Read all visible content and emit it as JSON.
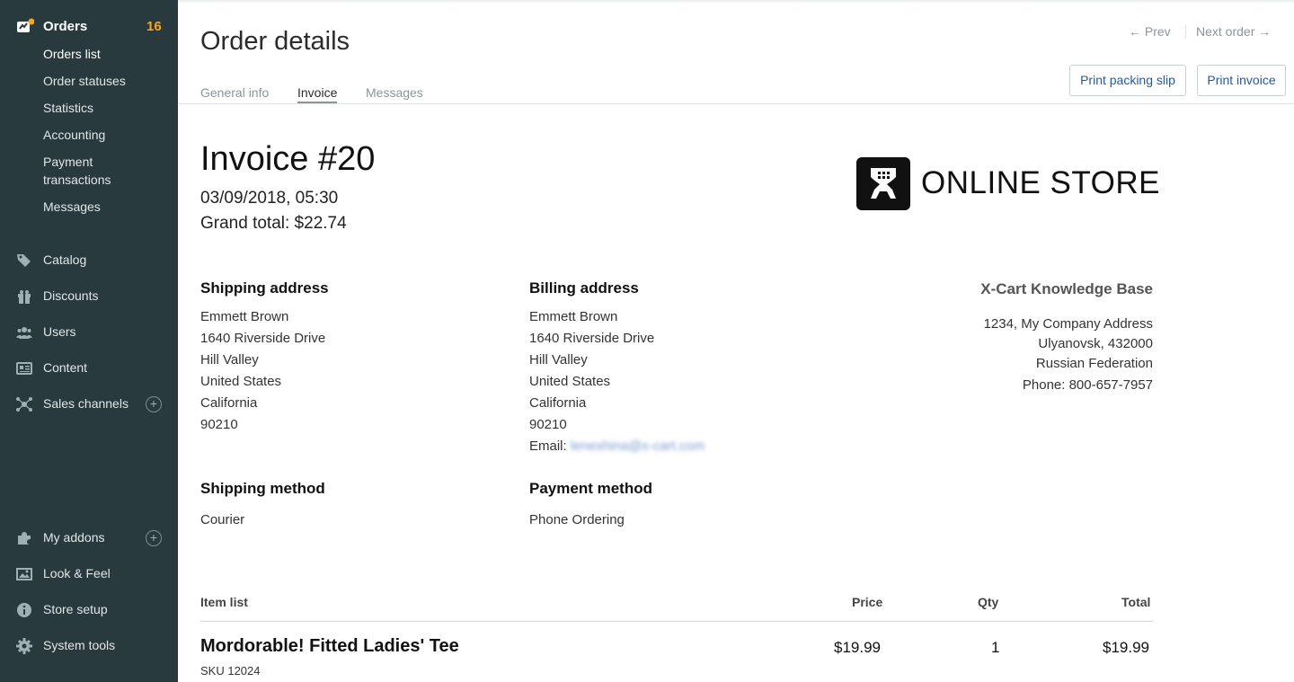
{
  "sidebar": {
    "orders": {
      "label": "Orders",
      "count": "16"
    },
    "sub_items": [
      "Orders list",
      "Order statuses",
      "Statistics",
      "Accounting",
      "Payment",
      "transactions",
      "Messages"
    ],
    "main_items": [
      {
        "label": "Catalog",
        "icon": "tags-icon"
      },
      {
        "label": "Discounts",
        "icon": "gift-icon"
      },
      {
        "label": "Users",
        "icon": "users-icon"
      },
      {
        "label": "Content",
        "icon": "newspaper-icon"
      },
      {
        "label": "Sales channels",
        "icon": "network-icon"
      },
      {
        "label": "My addons",
        "icon": "puzzle-icon"
      },
      {
        "label": "Look & Feel",
        "icon": "image-icon"
      },
      {
        "label": "Store setup",
        "icon": "info-icon"
      },
      {
        "label": "System tools",
        "icon": "gear-icon"
      }
    ]
  },
  "header": {
    "title": "Order details",
    "tabs": [
      "General info",
      "Invoice",
      "Messages"
    ],
    "prev": "←  Prev",
    "next": "Next order  →",
    "print_packing": "Print packing slip",
    "print_invoice": "Print invoice"
  },
  "invoice": {
    "title": "Invoice #20",
    "date": "03/09/2018, 05:30",
    "grand_total": "Grand total: $22.74",
    "logo_text": "ONLINE STORE",
    "shipping_address": {
      "heading": "Shipping address",
      "lines": [
        "Emmett  Brown",
        "1640 Riverside Drive",
        "Hill Valley",
        "United States",
        "California",
        "90210"
      ]
    },
    "billing_address": {
      "heading": "Billing address",
      "lines": [
        "Emmett  Brown",
        "1640 Riverside Drive",
        "Hill Valley",
        "United States",
        "California",
        "90210"
      ],
      "email_label": "Email:",
      "email_value": "lenexhina@x-cart.com"
    },
    "company": {
      "name": "X-Cart Knowledge Base",
      "lines": [
        "1234, My Company Address",
        "Ulyanovsk, 432000",
        "Russian Federation",
        "Phone: 800-657-7957"
      ]
    },
    "shipping_method": {
      "heading": "Shipping method",
      "value": "Courier"
    },
    "payment_method": {
      "heading": "Payment method",
      "value": "Phone Ordering"
    },
    "items_header": {
      "item": "Item list",
      "price": "Price",
      "qty": "Qty",
      "total": "Total"
    },
    "items": [
      {
        "name": "Mordorable! Fitted Ladies' Tee",
        "sku": "SKU 12024",
        "price": "$19.99",
        "qty": "1",
        "total": "$19.99"
      }
    ]
  },
  "colors": {
    "sidebar_bg": "#293a3e",
    "accent_badge": "#f5a623",
    "link": "#215aa1"
  }
}
